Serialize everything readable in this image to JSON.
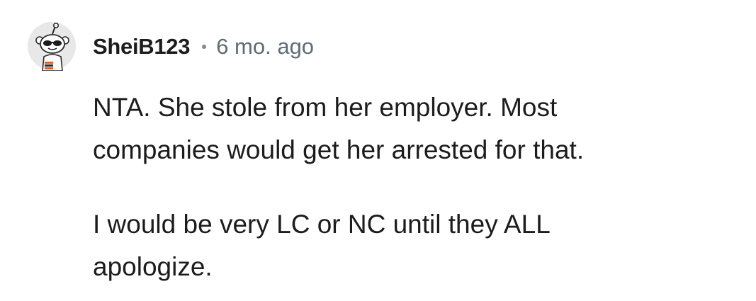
{
  "comment": {
    "author": {
      "username": "SheiB123",
      "avatar_icon": "snoo-sunglasses-avatar-icon"
    },
    "separator": "•",
    "timestamp": "6 mo. ago",
    "paragraphs": [
      "NTA. She stole from her employer. Most\ncompanies would get her arrested for that.",
      "I would be very LC or NC until they ALL\napologize."
    ]
  },
  "colors": {
    "text": "#1c1c1c",
    "timestamp": "#5f6c75",
    "separator_dot": "#7c8a94",
    "avatar_background": "#e8e8e8"
  }
}
